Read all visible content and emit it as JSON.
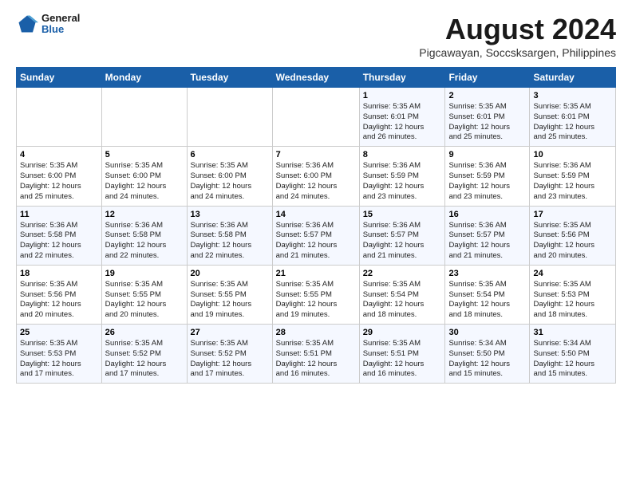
{
  "header": {
    "logo_line1": "General",
    "logo_line2": "Blue",
    "title": "August 2024",
    "subtitle": "Pigcawayan, Soccsksargen, Philippines"
  },
  "weekdays": [
    "Sunday",
    "Monday",
    "Tuesday",
    "Wednesday",
    "Thursday",
    "Friday",
    "Saturday"
  ],
  "weeks": [
    [
      {
        "day": "",
        "info": ""
      },
      {
        "day": "",
        "info": ""
      },
      {
        "day": "",
        "info": ""
      },
      {
        "day": "",
        "info": ""
      },
      {
        "day": "1",
        "info": "Sunrise: 5:35 AM\nSunset: 6:01 PM\nDaylight: 12 hours\nand 26 minutes."
      },
      {
        "day": "2",
        "info": "Sunrise: 5:35 AM\nSunset: 6:01 PM\nDaylight: 12 hours\nand 25 minutes."
      },
      {
        "day": "3",
        "info": "Sunrise: 5:35 AM\nSunset: 6:01 PM\nDaylight: 12 hours\nand 25 minutes."
      }
    ],
    [
      {
        "day": "4",
        "info": "Sunrise: 5:35 AM\nSunset: 6:00 PM\nDaylight: 12 hours\nand 25 minutes."
      },
      {
        "day": "5",
        "info": "Sunrise: 5:35 AM\nSunset: 6:00 PM\nDaylight: 12 hours\nand 24 minutes."
      },
      {
        "day": "6",
        "info": "Sunrise: 5:35 AM\nSunset: 6:00 PM\nDaylight: 12 hours\nand 24 minutes."
      },
      {
        "day": "7",
        "info": "Sunrise: 5:36 AM\nSunset: 6:00 PM\nDaylight: 12 hours\nand 24 minutes."
      },
      {
        "day": "8",
        "info": "Sunrise: 5:36 AM\nSunset: 5:59 PM\nDaylight: 12 hours\nand 23 minutes."
      },
      {
        "day": "9",
        "info": "Sunrise: 5:36 AM\nSunset: 5:59 PM\nDaylight: 12 hours\nand 23 minutes."
      },
      {
        "day": "10",
        "info": "Sunrise: 5:36 AM\nSunset: 5:59 PM\nDaylight: 12 hours\nand 23 minutes."
      }
    ],
    [
      {
        "day": "11",
        "info": "Sunrise: 5:36 AM\nSunset: 5:58 PM\nDaylight: 12 hours\nand 22 minutes."
      },
      {
        "day": "12",
        "info": "Sunrise: 5:36 AM\nSunset: 5:58 PM\nDaylight: 12 hours\nand 22 minutes."
      },
      {
        "day": "13",
        "info": "Sunrise: 5:36 AM\nSunset: 5:58 PM\nDaylight: 12 hours\nand 22 minutes."
      },
      {
        "day": "14",
        "info": "Sunrise: 5:36 AM\nSunset: 5:57 PM\nDaylight: 12 hours\nand 21 minutes."
      },
      {
        "day": "15",
        "info": "Sunrise: 5:36 AM\nSunset: 5:57 PM\nDaylight: 12 hours\nand 21 minutes."
      },
      {
        "day": "16",
        "info": "Sunrise: 5:36 AM\nSunset: 5:57 PM\nDaylight: 12 hours\nand 21 minutes."
      },
      {
        "day": "17",
        "info": "Sunrise: 5:35 AM\nSunset: 5:56 PM\nDaylight: 12 hours\nand 20 minutes."
      }
    ],
    [
      {
        "day": "18",
        "info": "Sunrise: 5:35 AM\nSunset: 5:56 PM\nDaylight: 12 hours\nand 20 minutes."
      },
      {
        "day": "19",
        "info": "Sunrise: 5:35 AM\nSunset: 5:55 PM\nDaylight: 12 hours\nand 20 minutes."
      },
      {
        "day": "20",
        "info": "Sunrise: 5:35 AM\nSunset: 5:55 PM\nDaylight: 12 hours\nand 19 minutes."
      },
      {
        "day": "21",
        "info": "Sunrise: 5:35 AM\nSunset: 5:55 PM\nDaylight: 12 hours\nand 19 minutes."
      },
      {
        "day": "22",
        "info": "Sunrise: 5:35 AM\nSunset: 5:54 PM\nDaylight: 12 hours\nand 18 minutes."
      },
      {
        "day": "23",
        "info": "Sunrise: 5:35 AM\nSunset: 5:54 PM\nDaylight: 12 hours\nand 18 minutes."
      },
      {
        "day": "24",
        "info": "Sunrise: 5:35 AM\nSunset: 5:53 PM\nDaylight: 12 hours\nand 18 minutes."
      }
    ],
    [
      {
        "day": "25",
        "info": "Sunrise: 5:35 AM\nSunset: 5:53 PM\nDaylight: 12 hours\nand 17 minutes."
      },
      {
        "day": "26",
        "info": "Sunrise: 5:35 AM\nSunset: 5:52 PM\nDaylight: 12 hours\nand 17 minutes."
      },
      {
        "day": "27",
        "info": "Sunrise: 5:35 AM\nSunset: 5:52 PM\nDaylight: 12 hours\nand 17 minutes."
      },
      {
        "day": "28",
        "info": "Sunrise: 5:35 AM\nSunset: 5:51 PM\nDaylight: 12 hours\nand 16 minutes."
      },
      {
        "day": "29",
        "info": "Sunrise: 5:35 AM\nSunset: 5:51 PM\nDaylight: 12 hours\nand 16 minutes."
      },
      {
        "day": "30",
        "info": "Sunrise: 5:34 AM\nSunset: 5:50 PM\nDaylight: 12 hours\nand 15 minutes."
      },
      {
        "day": "31",
        "info": "Sunrise: 5:34 AM\nSunset: 5:50 PM\nDaylight: 12 hours\nand 15 minutes."
      }
    ]
  ]
}
